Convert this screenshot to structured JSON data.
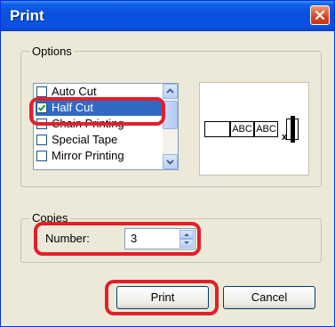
{
  "dialog": {
    "title": "Print"
  },
  "options": {
    "group_label": "Options",
    "items": [
      {
        "label": "Auto Cut",
        "checked": false
      },
      {
        "label": "Half Cut",
        "checked": true
      },
      {
        "label": "Chain Printing",
        "checked": false
      },
      {
        "label": "Special Tape",
        "checked": false
      },
      {
        "label": "Mirror Printing",
        "checked": false
      }
    ],
    "preview": {
      "segment_1": "ABC",
      "segment_2": "ABC",
      "cut_mark": "x"
    }
  },
  "copies": {
    "group_label": "Copies",
    "number_label": "Number:",
    "number_value": "3"
  },
  "buttons": {
    "print": "Print",
    "cancel": "Cancel"
  },
  "colors": {
    "highlight_red": "#e0202a",
    "title_blue": "#0a4fdc",
    "selection": "#316ac5"
  }
}
